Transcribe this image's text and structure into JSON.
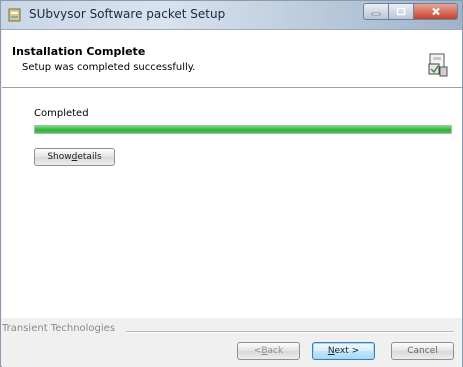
{
  "window": {
    "title": "SUbvysor Software packet Setup",
    "accent_color": "#c7422b"
  },
  "header": {
    "title": "Installation Complete",
    "subtitle": "Setup was completed successfully.",
    "icon": "installer-box-icon"
  },
  "body": {
    "status_label": "Completed",
    "progress_fraction": 1.0,
    "progress_color": "#2fb23b",
    "show_details": {
      "prefix": "Show ",
      "accel": "d",
      "suffix": "etails"
    }
  },
  "footer": {
    "brand": "Transient Technologies",
    "back": {
      "prefix": "< ",
      "accel": "B",
      "suffix": "ack"
    },
    "next": {
      "accel": "N",
      "suffix": "ext >"
    },
    "cancel_label": "Cancel"
  }
}
